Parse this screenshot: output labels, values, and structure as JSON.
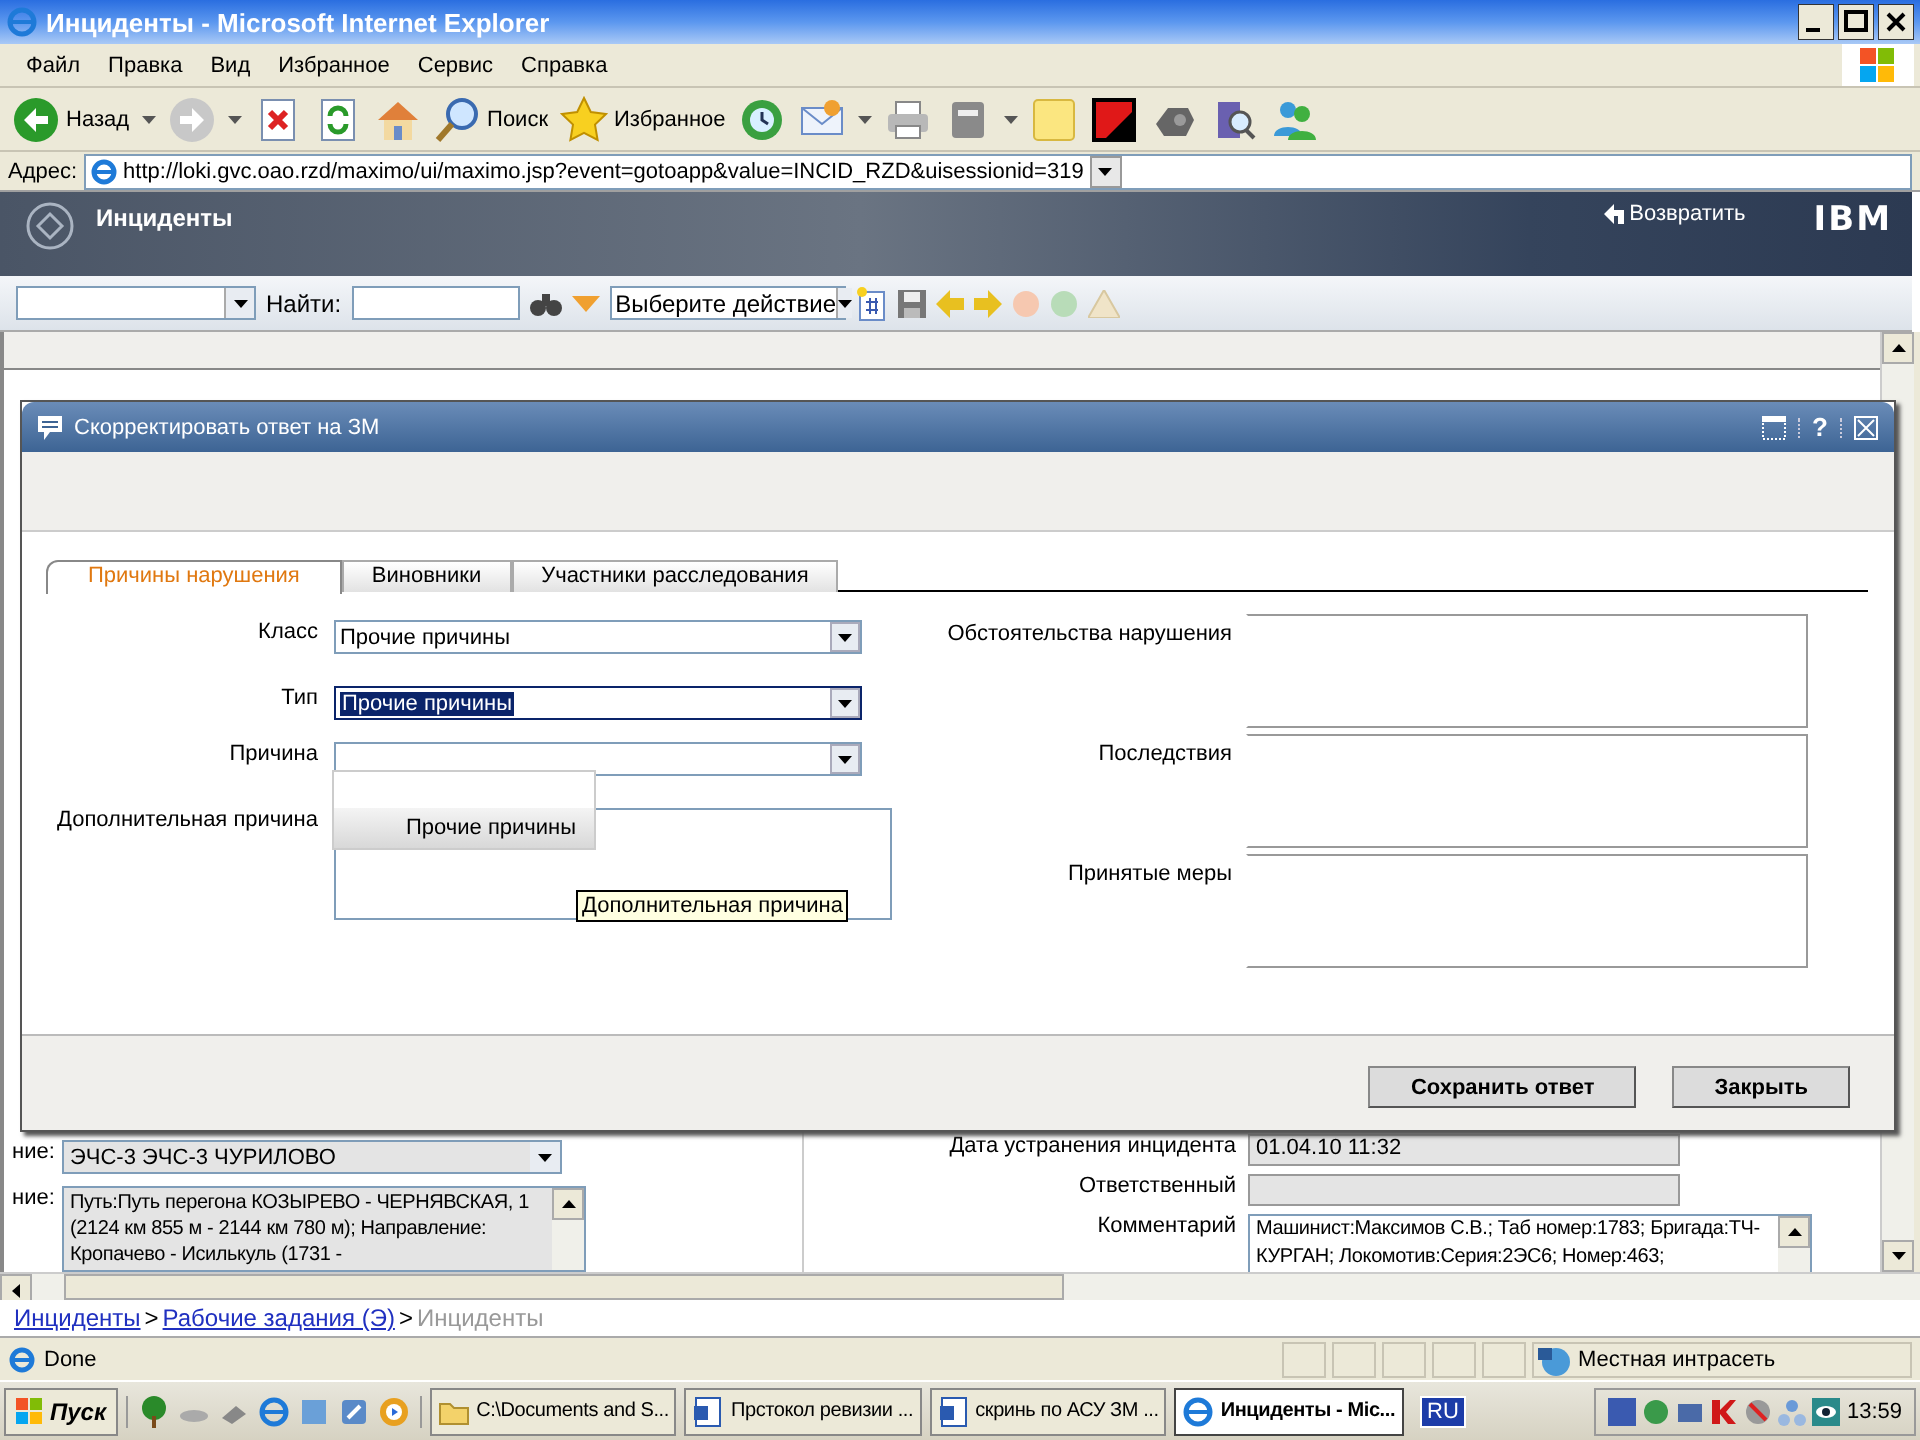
{
  "window": {
    "title": "Инциденты - Microsoft Internet Explorer"
  },
  "menu": [
    "Файл",
    "Правка",
    "Вид",
    "Избранное",
    "Сервис",
    "Справка"
  ],
  "toolbar": [
    {
      "kind": "back",
      "label": "Назад",
      "dropdown": true
    },
    {
      "kind": "forward",
      "dropdown": true
    },
    {
      "kind": "stop"
    },
    {
      "kind": "refresh"
    },
    {
      "kind": "home"
    },
    {
      "kind": "search",
      "label": "Поиск"
    },
    {
      "kind": "favorites",
      "label": "Избранное"
    },
    {
      "kind": "history"
    },
    {
      "kind": "mail",
      "dropdown": true
    },
    {
      "kind": "print"
    },
    {
      "kind": "edit",
      "dropdown": true
    },
    {
      "kind": "note"
    },
    {
      "kind": "shield"
    },
    {
      "kind": "gadget"
    },
    {
      "kind": "research"
    },
    {
      "kind": "people"
    }
  ],
  "address": {
    "label": "Адрес:",
    "url": "http://loki.gvc.oao.rzd/maximo/ui/maximo.jsp?event=gotoapp&value=INCID_RZD&uisessionid=319"
  },
  "app": {
    "title": "Инциденты",
    "return_link": "Возвратить",
    "brand": "IBM"
  },
  "app_toolbar": {
    "find_label": "Найти:",
    "action_select": "Выберите действие"
  },
  "background_form": {
    "left": [
      {
        "kind": "select",
        "label": "ние:",
        "value": "ЭЧС-3 ЭЧС-3 ЧУРИЛОВО"
      },
      {
        "kind": "textarea",
        "label": "ние:",
        "value": "Путь:Путь перегона КОЗЫРЕВО - ЧЕРНЯВСКАЯ, 1 (2124 км 855 м - 2144 км 780 м); Направление: Кропачево - Исилькуль (1731 -"
      }
    ],
    "right": [
      {
        "label": "Дата устранения инцидента",
        "value": "01.04.10 11:32"
      },
      {
        "label": "Ответственный"
      },
      {
        "label": "Комментарий",
        "value": "Машинист:Максимов С.В.; Таб номер:1783; Бригада:ТЧ-КУРГАН; Локомотив:Серия:2ЭС6; Номер:463;"
      }
    ]
  },
  "dialog": {
    "title": "Скорректировать ответ на ЗМ",
    "help": "?",
    "tabs": [
      {
        "label": "Причины нарушения",
        "selected": true
      },
      {
        "label": "Виновники",
        "selected": false
      },
      {
        "label": "Участники расследования",
        "selected": false
      }
    ],
    "fields": [
      {
        "label": "Класс",
        "value": "Прочие причины",
        "highlighted": false
      },
      {
        "label": "Тип",
        "value": "Прочие причины",
        "highlighted": true
      },
      {
        "label": "Причина",
        "highlighted": false
      }
    ],
    "extra_reason": {
      "label": "Дополнительная причина"
    },
    "dropdown": {
      "options": [
        "Прочие причины"
      ]
    },
    "tooltip": "Дополнительная причина",
    "text_areas": [
      "Обстоятельства нарушения",
      "Последствия",
      "Принятые меры"
    ],
    "buttons": [
      "Сохранить ответ",
      "Закрыть"
    ]
  },
  "breadcrumb": {
    "separator": ">",
    "items": [
      {
        "label": "Инциденты",
        "link": true
      },
      {
        "label": "Рабочие задания (Э)",
        "link": true
      },
      {
        "label": "Инциденты",
        "link": false
      }
    ]
  },
  "status_bar": {
    "text": "Done",
    "zone": "Местная интрасеть"
  },
  "taskbar": {
    "start": "Пуск",
    "tasks": [
      {
        "kind": "folder",
        "label": "C:\\Documents and S...",
        "selected": false
      },
      {
        "kind": "word",
        "label": "Прстокол ревизии ...",
        "selected": false
      },
      {
        "kind": "word",
        "label": "скринь по АСУ ЗМ ...",
        "selected": false
      },
      {
        "kind": "ie",
        "label": "Инциденты - Mic...",
        "selected": true
      }
    ],
    "language": "RU",
    "clock": "13:59"
  }
}
